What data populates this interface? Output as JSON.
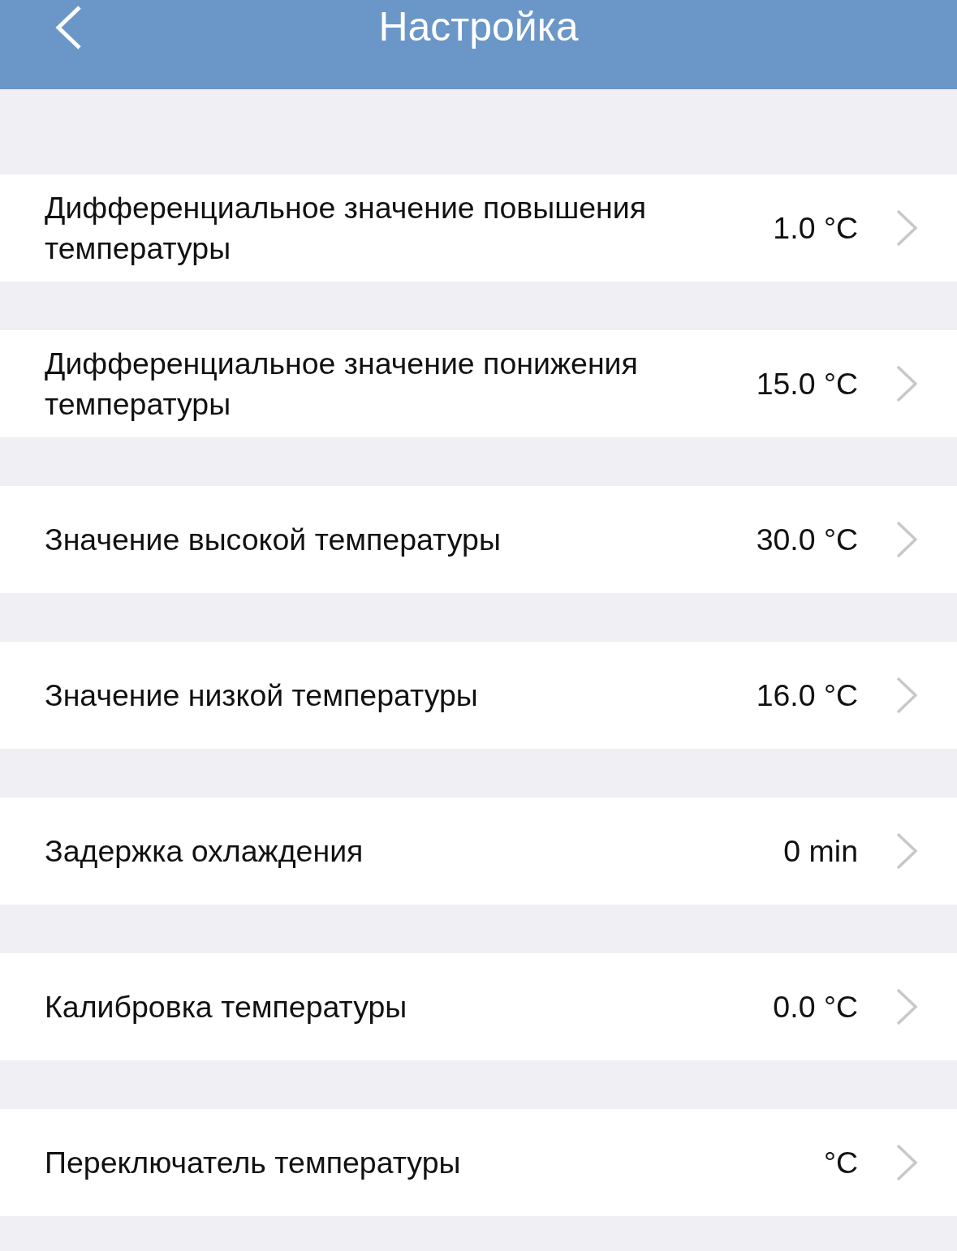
{
  "header": {
    "title": "Настройка"
  },
  "settings": [
    {
      "label": "Дифференциальное значение повышения температуры",
      "value": "1.0 °C"
    },
    {
      "label": "Дифференциальное значение понижения температуры",
      "value": "15.0 °C"
    },
    {
      "label": "Значение высокой температуры",
      "value": "30.0 °C"
    },
    {
      "label": "Значение низкой температуры",
      "value": "16.0 °C"
    },
    {
      "label": "Задержка охлаждения",
      "value": "0 min"
    },
    {
      "label": "Калибровка температуры",
      "value": "0.0 °C"
    },
    {
      "label": "Переключатель температуры",
      "value": "°C"
    }
  ]
}
